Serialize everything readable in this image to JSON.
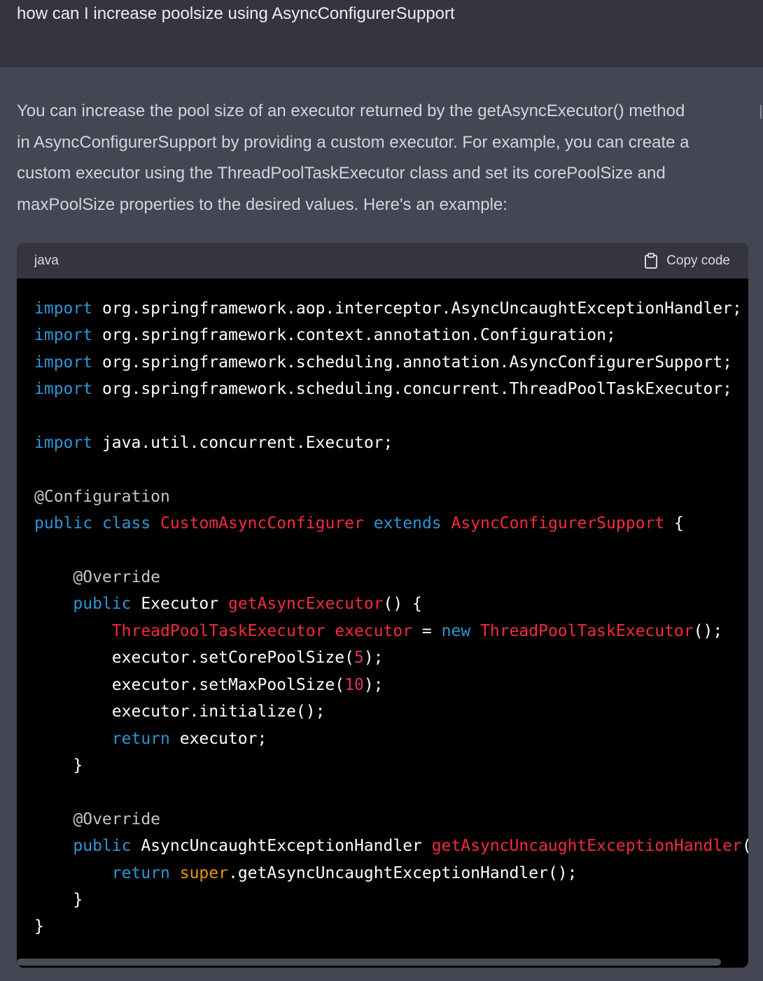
{
  "user_message": "how can I increase poolsize using AsyncConfigurerSupport",
  "assistant_message": {
    "lines": [
      "You can increase the pool size of an executor returned by the getAsyncExecutor() method",
      "in AsyncConfigurerSupport by providing a custom executor. For example, you can create a",
      "custom executor using the ThreadPoolTaskExecutor class and set its corePoolSize and",
      "maxPoolSize properties to the desired values. Here's an example:"
    ]
  },
  "code_block": {
    "language": "java",
    "copy_label": "Copy code",
    "copy_icon": "clipboard-icon",
    "code": {
      "import_kw": "import",
      "import1_path": " org.springframework.aop.interceptor.AsyncUncaughtExceptionHandler;",
      "import2_path": " org.springframework.context.annotation.Configuration;",
      "import3_path": " org.springframework.scheduling.annotation.AsyncConfigurerSupport;",
      "import4_path": " org.springframework.scheduling.concurrent.ThreadPoolTaskExecutor;",
      "import5_path": " java.util.concurrent.Executor;",
      "annotation_configuration": "@Configuration",
      "public_kw": "public",
      "class_kw": "class",
      "class_name": "CustomAsyncConfigurer",
      "extends_kw": "extends",
      "super_class": "AsyncConfigurerSupport",
      "override_annotation": "@Override",
      "executor_type": " Executor ",
      "method_get_async_executor": "getAsyncExecutor",
      "tpte_type": "ThreadPoolTaskExecutor",
      "executor_var": "executor",
      "new_kw": "new",
      "set_core_call": "executor.setCorePoolSize(",
      "core_value": "5",
      "set_max_call": "executor.setMaxPoolSize(",
      "max_value": "10",
      "initialize_call": "executor.initialize();",
      "return_kw": "return",
      "return_executor": " executor;",
      "handler_type": " AsyncUncaughtExceptionHandler ",
      "method_get_handler": "getAsyncUncaughtExceptionHandler",
      "super_kw": "super",
      "super_call": ".getAsyncUncaughtExceptionHandler();"
    }
  },
  "colors": {
    "page_background": "#444654",
    "user_row_background": "#343541",
    "code_background": "#000000",
    "keyword": "#2e95d3",
    "type_name": "#f22c3d",
    "number": "#df3079",
    "super_keyword": "#e9950c",
    "annotation": "#c5c5d2"
  }
}
